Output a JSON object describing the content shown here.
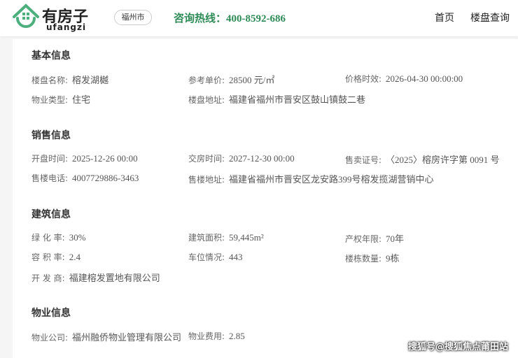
{
  "header": {
    "logo_cn": "有房子",
    "logo_en": "ufangzi",
    "city": "福州市",
    "hotline_label": "咨询热线：",
    "hotline_number": "400-8592-686",
    "nav": [
      "首页",
      "楼盘查询"
    ]
  },
  "sections": [
    {
      "title": "基本信息",
      "fields": [
        {
          "k": "楼盘名称:",
          "v": "榕发湖樾"
        },
        {
          "k": "参考单价:",
          "v": "28500 元/㎡"
        },
        {
          "k": "价格时效:",
          "v": "2026-04-30 00:00:00"
        },
        {
          "k": "物业类型:",
          "v": "住宅"
        },
        {
          "k": "楼盘地址:",
          "v": "福建省福州市晋安区鼓山镇鼓二巷"
        }
      ]
    },
    {
      "title": "销售信息",
      "fields": [
        {
          "k": "开盘时间:",
          "v": "2025-12-26 00:00"
        },
        {
          "k": "交房时间:",
          "v": "2027-12-30 00:00"
        },
        {
          "k": "售卖证号:",
          "v": "〈2025〉榕房许字第 0091 号"
        },
        {
          "k": "售楼电话:",
          "v": "4007729886-3463"
        },
        {
          "k": "售楼地址:",
          "v": "福建省福州市晋安区龙安路399号榕发揽湖营销中心"
        }
      ]
    },
    {
      "title": "建筑信息",
      "fields": [
        {
          "k": "绿 化 率:",
          "v": "30%"
        },
        {
          "k": "建筑面积:",
          "v": "59,445m²"
        },
        {
          "k": "产权年限:",
          "v": "70年"
        },
        {
          "k": "容 积 率:",
          "v": "2.4"
        },
        {
          "k": "车位情况:",
          "v": "443"
        },
        {
          "k": "楼栋数量:",
          "v": "9栋"
        },
        {
          "k": "开 发 商:",
          "v": "福建榕发置地有限公司"
        }
      ]
    },
    {
      "title": "物业信息",
      "fields": [
        {
          "k": "物业公司:",
          "v": "福州融侨物业管理有限公司"
        },
        {
          "k": "物业费用:",
          "v": "2.85"
        }
      ]
    }
  ],
  "watermark": "搜狐号@搜狐焦点莆田站",
  "colors": {
    "brand": "#2e8b57"
  }
}
